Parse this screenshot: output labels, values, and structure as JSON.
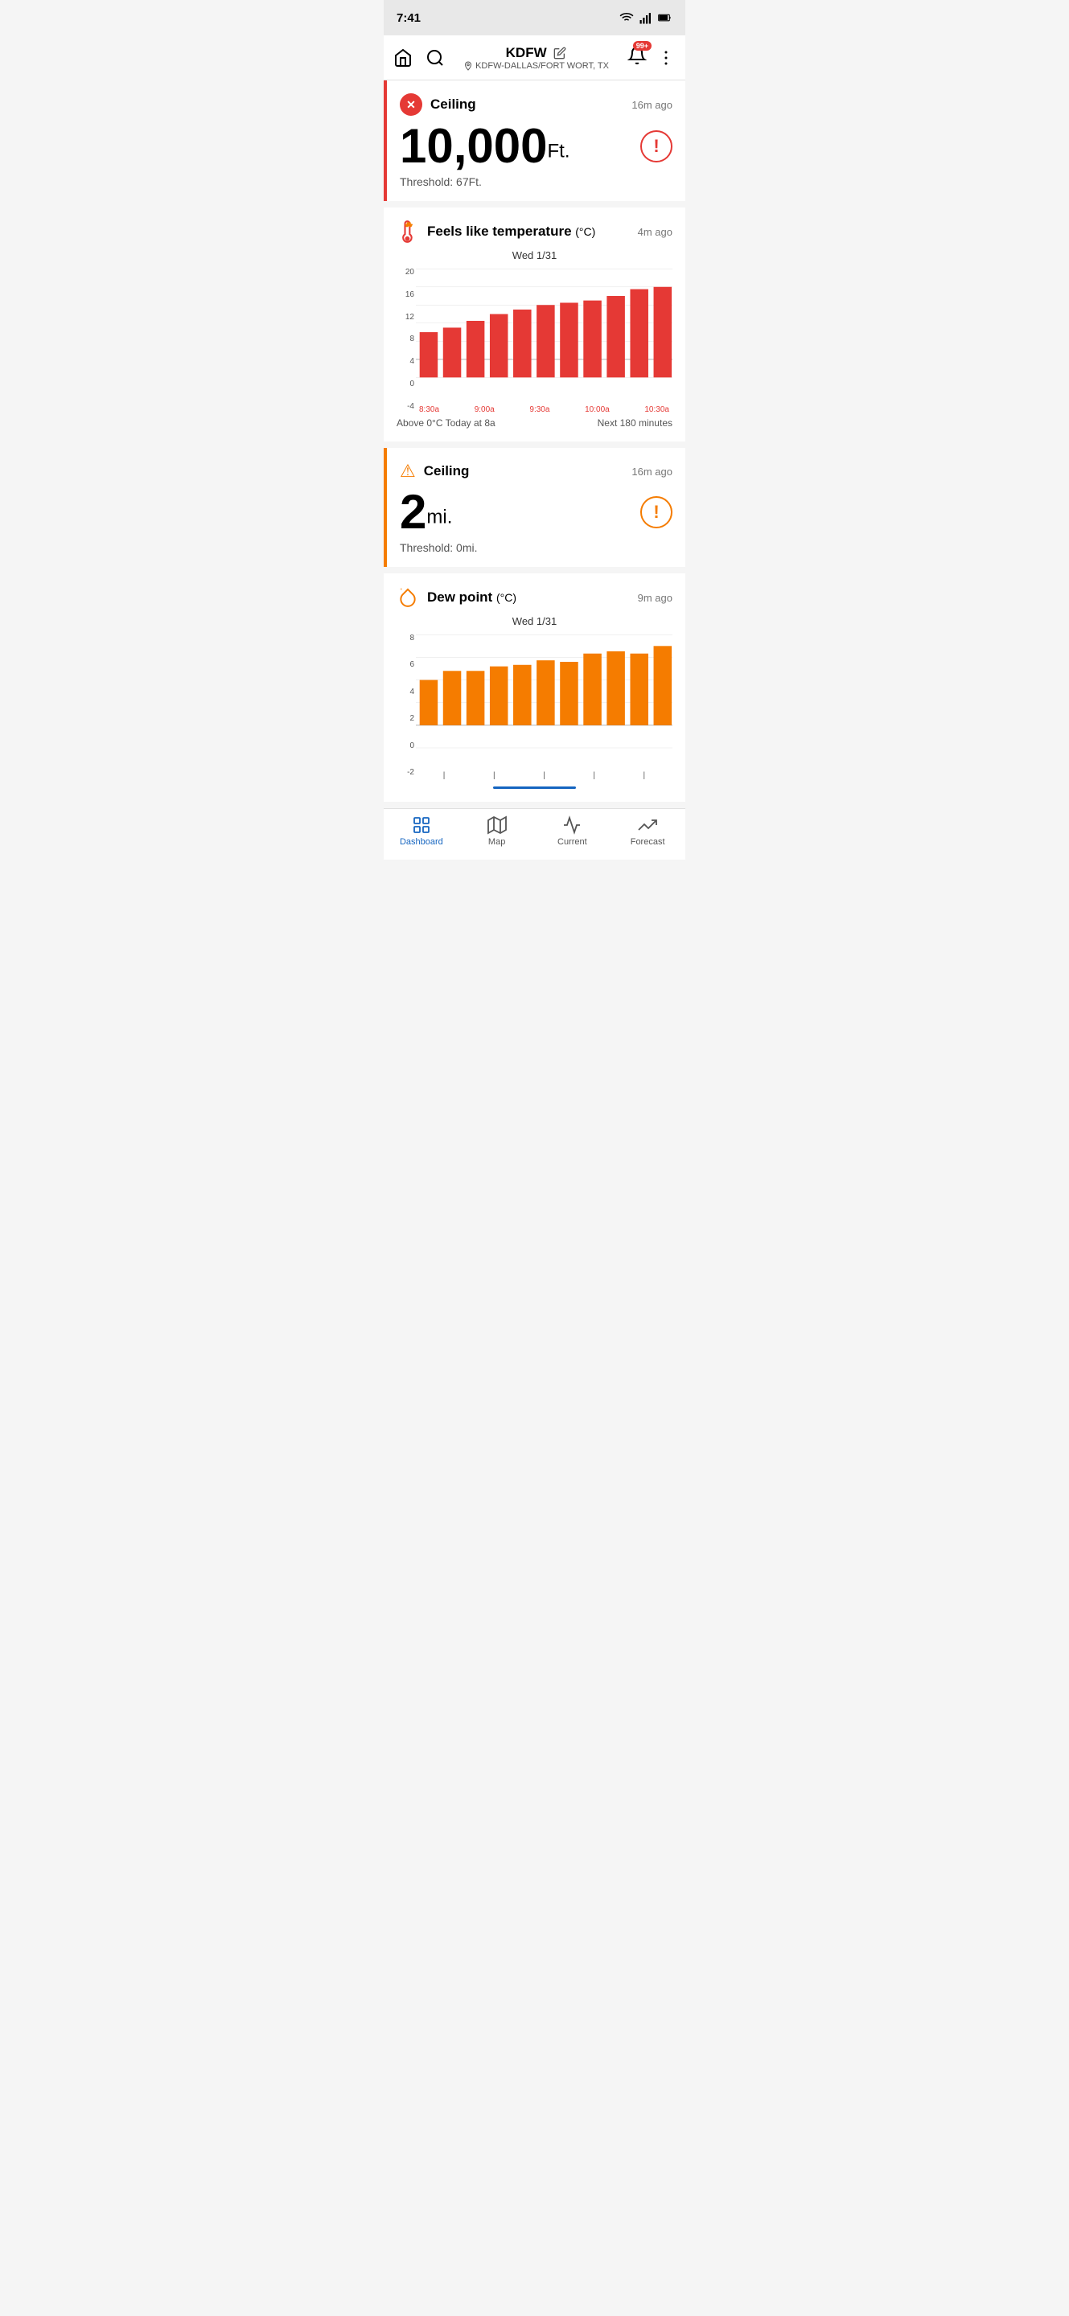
{
  "statusBar": {
    "time": "7:41",
    "batteryIcon": "battery",
    "wifiIcon": "wifi",
    "signalIcon": "signal"
  },
  "navBar": {
    "station": "KDFW",
    "location": "KDFW-DALLAS/FORT WORT, TX",
    "notificationBadge": "99+",
    "homeIcon": "home",
    "searchIcon": "search",
    "notificationIcon": "bell",
    "moreIcon": "more-vertical"
  },
  "sections": [
    {
      "id": "ceiling-alert",
      "type": "value",
      "alertType": "red",
      "title": "Ceiling",
      "time": "16m ago",
      "value": "10,000",
      "unit": "Ft.",
      "threshold": "Threshold: 67Ft.",
      "alertCircle": "red"
    },
    {
      "id": "feels-like",
      "type": "chart",
      "alertType": "orange-thermometer",
      "title": "Feels like temperature",
      "titleSuffix": "(°C)",
      "time": "4m ago",
      "chartDate": "Wed 1/31",
      "chartColor": "#e53935",
      "yLabels": [
        "20",
        "16",
        "12",
        "8",
        "4",
        "0",
        "-4"
      ],
      "xLabels": [
        "8:30a",
        "9:00a",
        "9:30a",
        "10:00a",
        "10:30a"
      ],
      "bars": [
        6,
        7,
        8.5,
        10,
        11,
        12,
        12.5,
        13,
        14,
        15.5,
        16
      ],
      "footerLeft": "Above 0°C Today at 8a",
      "footerRight": "Next 180 minutes"
    },
    {
      "id": "ceiling-warning",
      "type": "value",
      "alertType": "orange",
      "title": "Ceiling",
      "time": "16m ago",
      "value": "2",
      "unit": "mi.",
      "threshold": "Threshold: 0mi.",
      "alertCircle": "orange"
    },
    {
      "id": "dew-point",
      "type": "chart",
      "alertType": "orange-dew",
      "title": "Dew point",
      "titleSuffix": "(°C)",
      "time": "9m ago",
      "chartDate": "Wed 1/31",
      "chartColor": "#f57c00",
      "yLabels": [
        "8",
        "6",
        "4",
        "2",
        "0",
        "-2"
      ],
      "xLabels": [
        "",
        "",
        "",
        "",
        ""
      ],
      "bars": [
        4,
        4.8,
        4.8,
        5.2,
        5.3,
        5.7,
        5.6,
        6.3,
        6.5,
        6.3,
        7.0
      ],
      "footerLeft": "",
      "footerRight": ""
    }
  ],
  "bottomNav": [
    {
      "id": "dashboard",
      "label": "Dashboard",
      "icon": "dashboard",
      "active": true
    },
    {
      "id": "map",
      "label": "Map",
      "icon": "map",
      "active": false
    },
    {
      "id": "current",
      "label": "Current",
      "icon": "current",
      "active": false
    },
    {
      "id": "forecast",
      "label": "Forecast",
      "icon": "forecast",
      "active": false
    }
  ]
}
